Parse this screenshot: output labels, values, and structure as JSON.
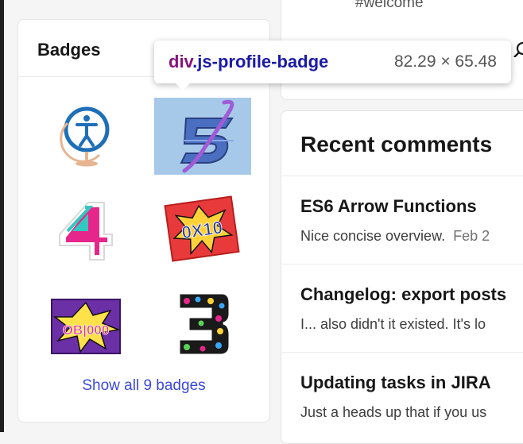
{
  "badges": {
    "title": "Badges",
    "show_all_label": "Show all 9 badges"
  },
  "top_card": {
    "tag": "#welcome",
    "icon": "magnifier-icon"
  },
  "recent_comments": {
    "title": "Recent comments",
    "items": [
      {
        "title": "ES6 Arrow Functions",
        "body": "Nice concise overview.",
        "date": "Feb 2"
      },
      {
        "title": "Changelog: export posts",
        "body": "I... also didn't it existed. It's lo",
        "date": ""
      },
      {
        "title": "Updating tasks in JIRA",
        "body": "Just a heads up that if you us",
        "date": ""
      }
    ]
  },
  "inspector_tooltip": {
    "tag": "div",
    "class_name": ".js-profile-badge",
    "dimensions": "82.29 × 65.48"
  },
  "colors": {
    "link": "#3b49df",
    "tooltip_tag": "#881280",
    "tooltip_class": "#1a1aa6",
    "highlight": "#6fa8dc"
  }
}
